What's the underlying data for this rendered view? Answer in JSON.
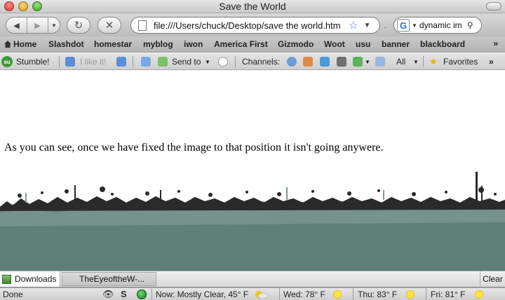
{
  "window": {
    "title": "Save the World"
  },
  "nav": {
    "url": "file:///Users/chuck/Desktop/save the world.htm",
    "search_value": "dynamic im",
    "search_engine_icon": "G"
  },
  "bookmarks": {
    "home": "Home",
    "items": [
      "Slashdot",
      "homestar",
      "myblog",
      "iwon",
      "America First",
      "Gizmodo",
      "Woot",
      "usu",
      "banner",
      "blackboard"
    ],
    "overflow": "»"
  },
  "stumble": {
    "logo": "su",
    "stumble_label": "Stumble!",
    "like_label": "I like it!",
    "send_label": "Send to",
    "channels_label": "Channels:",
    "all_label": "All",
    "favorites_label": "Favorites",
    "overflow": "»"
  },
  "content": {
    "paragraph": "As you can see, once we have fixed the image to that position it isn't going anywere."
  },
  "downloads": {
    "tab_label": "Downloads",
    "item_label": "TheEyeoftheW-...",
    "clear_label": "Clear"
  },
  "status": {
    "text": "Done",
    "skype_letter": "S",
    "now": "Now: Mostly Clear, 45° F",
    "wed": "Wed: 78° F",
    "thu": "Thu: 83° F",
    "fri": "Fri: 81° F"
  },
  "colors": {
    "grass": "#5f7f78",
    "grass_dark": "#2a2a2a",
    "accent_blue": "#4a7bd0",
    "stumble_green": "#3d9a3a"
  }
}
